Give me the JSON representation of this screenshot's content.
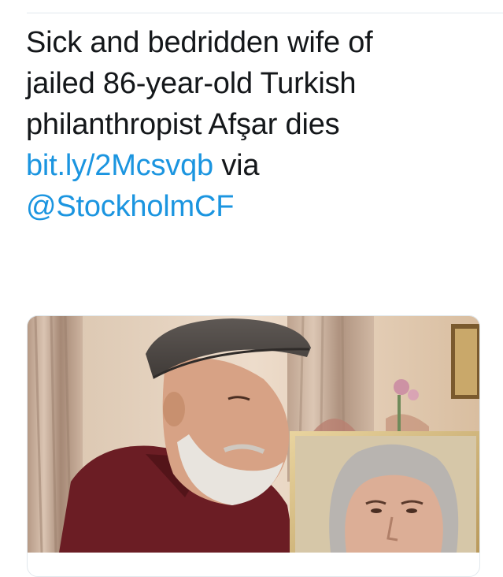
{
  "tweet": {
    "text_lines": [
      "Sick and bedridden wife of",
      "jailed 86-year-old Turkish",
      "philanthropist Afşar dies"
    ],
    "link": "bit.ly/2Mcsvqb",
    "via_word": "via",
    "mention": "@StockholmCF"
  },
  "card": {
    "image_icon": "news-photo",
    "colors": {
      "link": "#1b95e0",
      "text": "#14171a",
      "border": "#e1e8ed"
    }
  }
}
